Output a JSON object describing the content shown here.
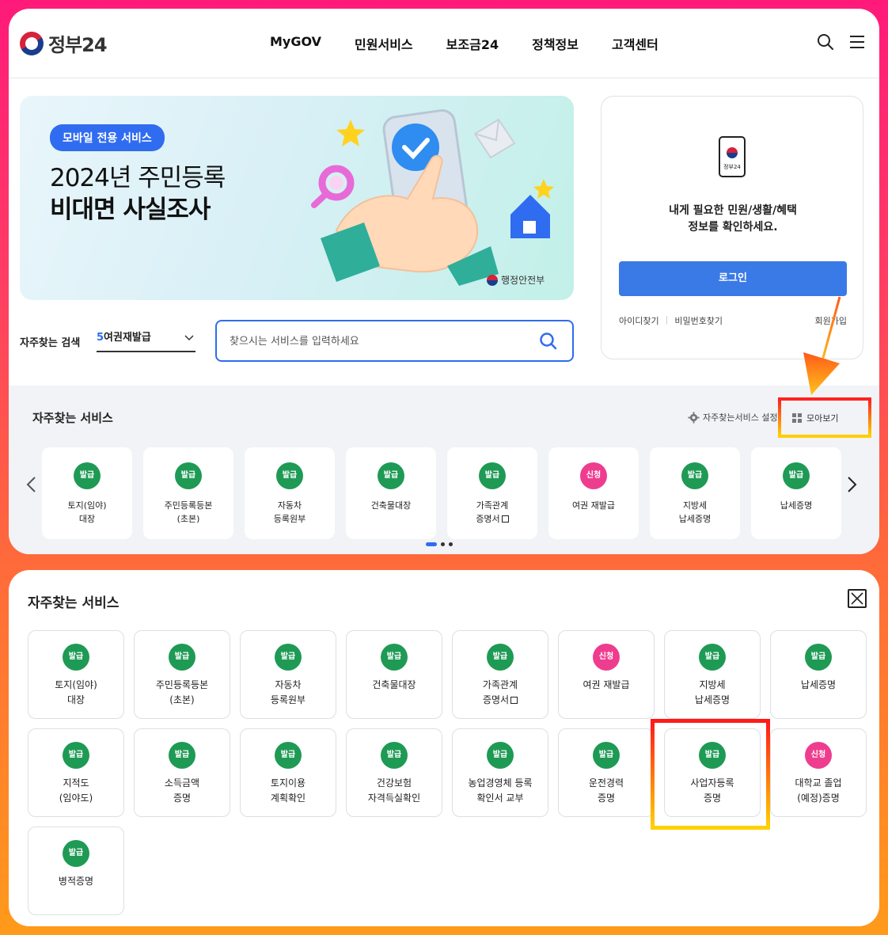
{
  "header": {
    "logo_text": "정부24",
    "nav": [
      "MyGOV",
      "민원서비스",
      "보조금24",
      "정책정보",
      "고객센터"
    ]
  },
  "banner": {
    "badge": "모바일 전용 서비스",
    "title_line1": "2024년 주민등록",
    "title_line2": "비대면 사실조사",
    "org": "행정안전부"
  },
  "login": {
    "app_label": "정부24",
    "message_line1": "내게 필요한 민원/생활/혜택",
    "message_line2": "정보를 확인하세요.",
    "button": "로그인",
    "find_id": "아이디찾기",
    "find_pw": "비밀번호찾기",
    "signup": "회원가입"
  },
  "search": {
    "fav_label": "자주찾는 검색",
    "selected_num": "5",
    "selected_text": "여권재발급",
    "placeholder": "찾으시는 서비스를 입력하세요"
  },
  "fav_strip": {
    "title": "자주찾는 서비스",
    "settings": "자주찾는서비스 설정",
    "view_all": "모아보기",
    "cards": [
      {
        "badge": "발급",
        "label": "토지(임야)\n대장"
      },
      {
        "badge": "발급",
        "label": "주민등록등본\n(초본)"
      },
      {
        "badge": "발급",
        "label": "자동차\n등록원부"
      },
      {
        "badge": "발급",
        "label": "건축물대장"
      },
      {
        "badge": "발급",
        "label": "가족관계\n증명서"
      },
      {
        "badge": "신청",
        "label": "여권 재발급"
      },
      {
        "badge": "발급",
        "label": "지방세\n납세증명"
      },
      {
        "badge": "발급",
        "label": "납세증명"
      }
    ]
  },
  "bottom_panel": {
    "title": "자주찾는 서비스",
    "cards": [
      {
        "badge": "발급",
        "label": "토지(임야)\n대장"
      },
      {
        "badge": "발급",
        "label": "주민등록등본\n(초본)"
      },
      {
        "badge": "발급",
        "label": "자동차\n등록원부"
      },
      {
        "badge": "발급",
        "label": "건축물대장"
      },
      {
        "badge": "발급",
        "label": "가족관계\n증명서"
      },
      {
        "badge": "신청",
        "label": "여권 재발급"
      },
      {
        "badge": "발급",
        "label": "지방세\n납세증명"
      },
      {
        "badge": "발급",
        "label": "납세증명"
      },
      {
        "badge": "발급",
        "label": "지적도\n(임야도)"
      },
      {
        "badge": "발급",
        "label": "소득금액\n증명"
      },
      {
        "badge": "발급",
        "label": "토지이용\n계획확인"
      },
      {
        "badge": "발급",
        "label": "건강보험\n자격득실확인"
      },
      {
        "badge": "발급",
        "label": "농업경영체 등록\n확인서 교부"
      },
      {
        "badge": "발급",
        "label": "운전경력\n증명"
      },
      {
        "badge": "발급",
        "label": "사업자등록\n증명"
      },
      {
        "badge": "신청",
        "label": "대학교 졸업\n(예정)증명"
      },
      {
        "badge": "발급",
        "label": "병적증명"
      }
    ]
  },
  "colors": {
    "accent_blue": "#2f6cf0",
    "badge_green": "#1e9a55",
    "badge_pink": "#ee3d8f"
  }
}
